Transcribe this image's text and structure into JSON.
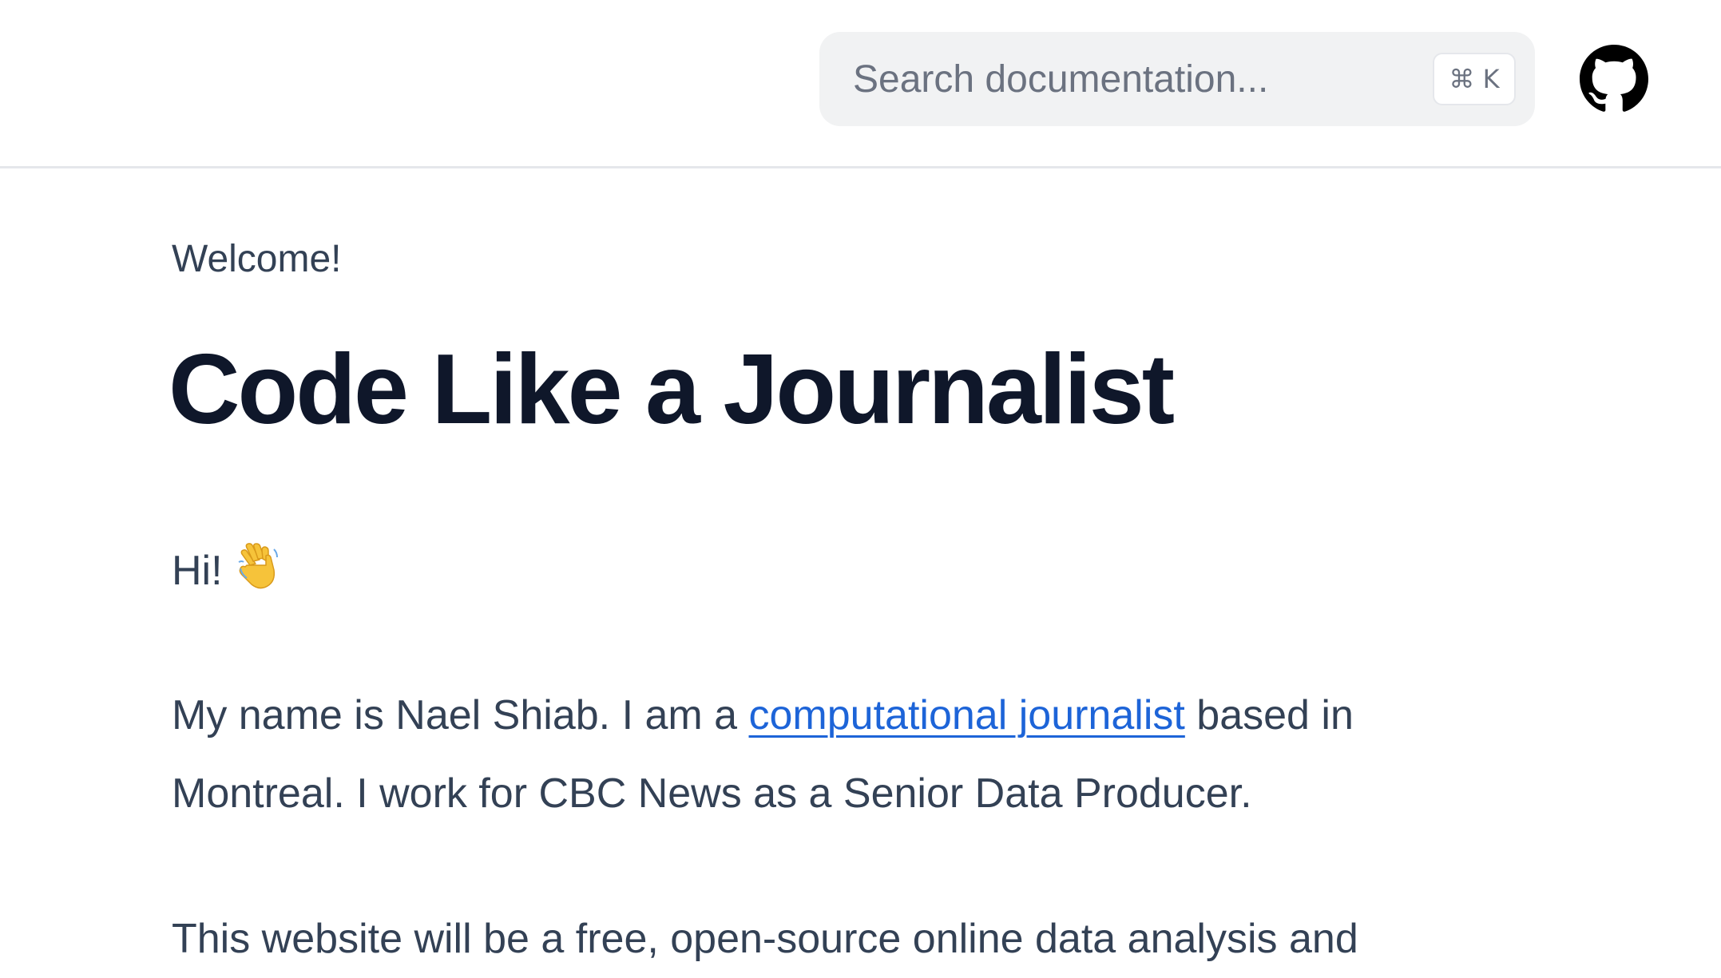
{
  "header": {
    "search": {
      "placeholder": "Search documentation...",
      "shortcut": "⌘ K"
    },
    "github_icon": "github-icon"
  },
  "main": {
    "eyebrow": "Welcome!",
    "title": "Code Like a Journalist",
    "greeting": {
      "text": "Hi!",
      "emoji": "waving-hand"
    },
    "intro": {
      "before_link": "My name is Nael Shiab. I am a ",
      "link_text": "computational journalist",
      "after_link": " based in Montreal. I work for CBC News as a Senior Data Producer."
    },
    "site_description": "This website will be a free, open-source online data analysis and"
  },
  "colors": {
    "link": "#1d64d8",
    "heading": "#0f172a",
    "body_text": "#334155",
    "search_bg": "#f1f2f3"
  }
}
